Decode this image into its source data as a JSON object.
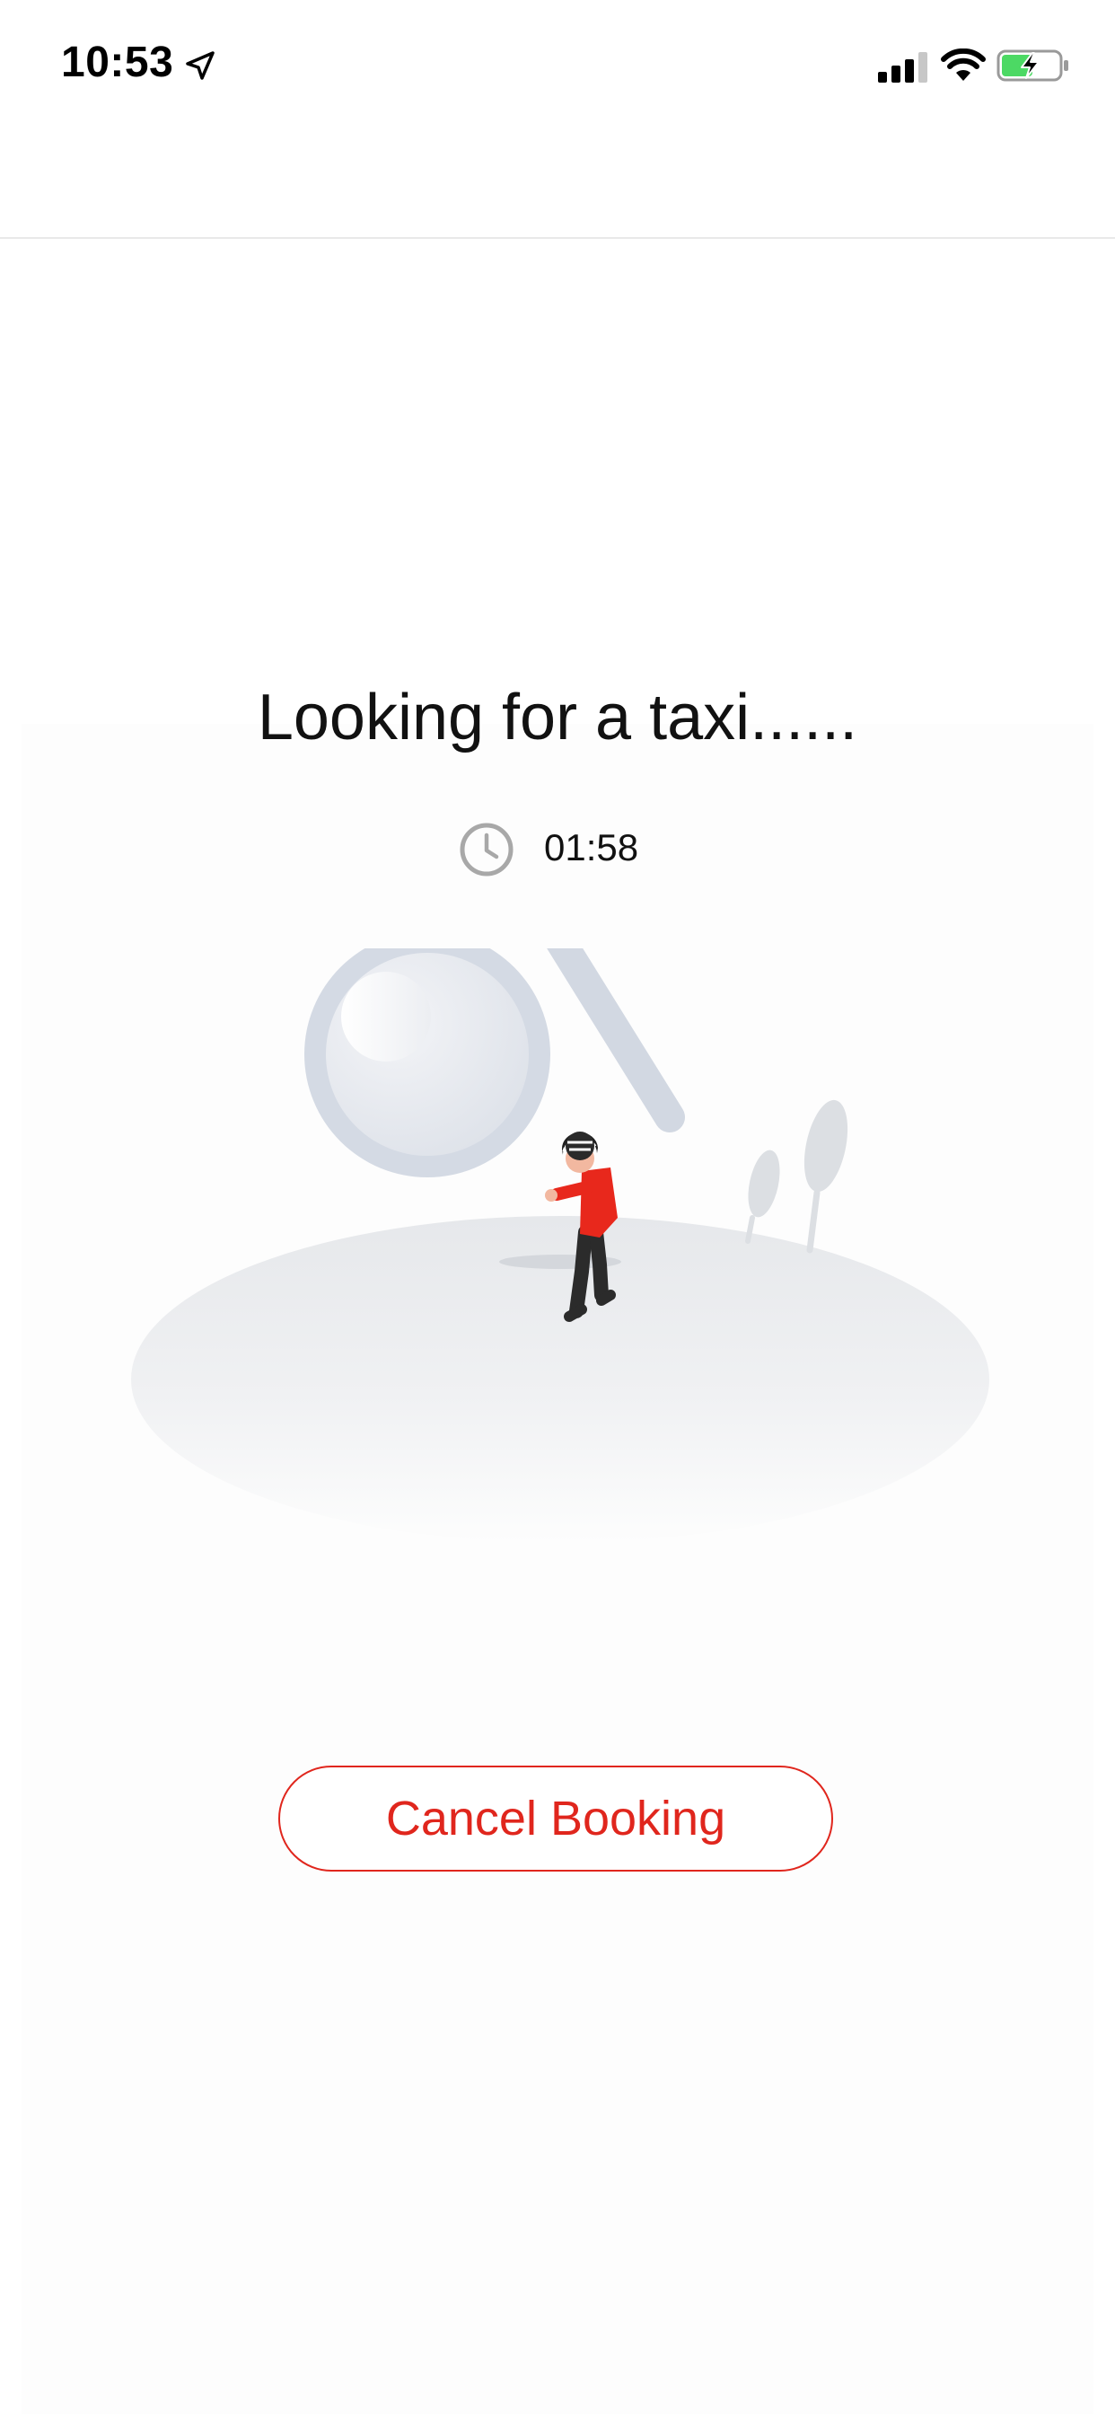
{
  "status_bar": {
    "time": "10:53",
    "icons": [
      "location-arrow-icon",
      "signal-icon",
      "wifi-icon",
      "battery-charging-icon"
    ]
  },
  "main": {
    "title": "Looking for a taxi......",
    "timer": "01:58",
    "clock_icon": "clock-icon",
    "illustration": "person-with-magnifying-glass"
  },
  "actions": {
    "cancel_label": "Cancel Booking"
  },
  "colors": {
    "accent": "#e0261d",
    "text": "#111111",
    "battery_green": "#4cd964"
  }
}
